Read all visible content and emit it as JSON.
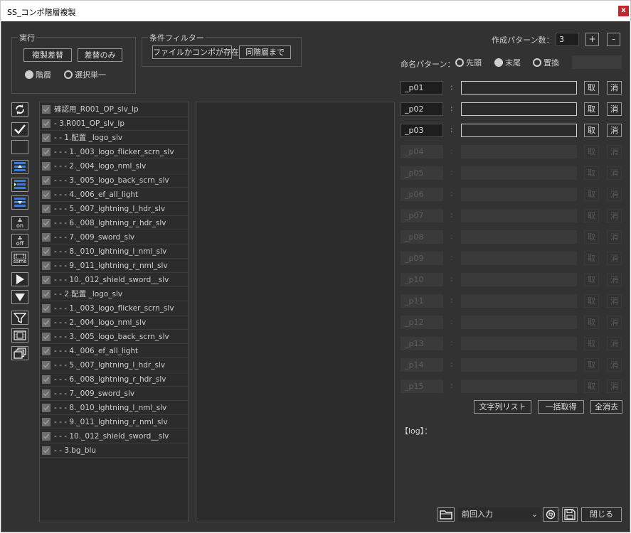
{
  "window": {
    "title": "SS_コンポ階層複製",
    "close": "x"
  },
  "execute": {
    "title": "実行",
    "duplicate_replace": "複製差替",
    "replace_only": "差替のみ",
    "modes": [
      {
        "label": "階層",
        "selected": true
      },
      {
        "label": "選択単一",
        "selected": false
      }
    ]
  },
  "filter": {
    "title": "条件フィルター",
    "file_or_comp": "ファイルかコンポが存在",
    "same_level": "同階層まで"
  },
  "pattern_count": {
    "label": "作成パターン数：",
    "value": "3",
    "plus": "+",
    "minus": "-"
  },
  "naming": {
    "label": "命名パターン：",
    "options": [
      {
        "label": "先頭",
        "selected": false
      },
      {
        "label": "末尾",
        "selected": true
      },
      {
        "label": "置換",
        "selected": false
      }
    ]
  },
  "patterns": [
    {
      "name": "_p01",
      "value": "",
      "get": "取",
      "del": "消",
      "enabled": true
    },
    {
      "name": "_p02",
      "value": "",
      "get": "取",
      "del": "消",
      "enabled": true
    },
    {
      "name": "_p03",
      "value": "",
      "get": "取",
      "del": "消",
      "enabled": true
    },
    {
      "name": "_p04",
      "value": "",
      "get": "取",
      "del": "消",
      "enabled": false
    },
    {
      "name": "_p05",
      "value": "",
      "get": "取",
      "del": "消",
      "enabled": false
    },
    {
      "name": "_p06",
      "value": "",
      "get": "取",
      "del": "消",
      "enabled": false
    },
    {
      "name": "_p07",
      "value": "",
      "get": "取",
      "del": "消",
      "enabled": false
    },
    {
      "name": "_p08",
      "value": "",
      "get": "取",
      "del": "消",
      "enabled": false
    },
    {
      "name": "_p09",
      "value": "",
      "get": "取",
      "del": "消",
      "enabled": false
    },
    {
      "name": "_p10",
      "value": "",
      "get": "取",
      "del": "消",
      "enabled": false
    },
    {
      "name": "_p11",
      "value": "",
      "get": "取",
      "del": "消",
      "enabled": false
    },
    {
      "name": "_p12",
      "value": "",
      "get": "取",
      "del": "消",
      "enabled": false
    },
    {
      "name": "_p13",
      "value": "",
      "get": "取",
      "del": "消",
      "enabled": false
    },
    {
      "name": "_p14",
      "value": "",
      "get": "取",
      "del": "消",
      "enabled": false
    },
    {
      "name": "_p15",
      "value": "",
      "get": "取",
      "del": "消",
      "enabled": false
    }
  ],
  "pattern_colon": ":",
  "actions": {
    "string_list": "文字列リスト",
    "get_all": "一括取得",
    "clear_all": "全消去"
  },
  "log_label": "【log】：",
  "footer": {
    "prev_input": "前回入力",
    "close": "閉じる"
  },
  "toolbar_icons": [
    "refresh-icon",
    "check-all-icon",
    "uncheck-all-icon",
    "collapse-up-icon",
    "indent-icon",
    "collapse-down-icon",
    "on-icon",
    "off-icon",
    "same-icon",
    "play-icon",
    "expand-down-icon",
    "filter-icon",
    "film-icon",
    "layers-icon"
  ],
  "toolbar_text": {
    "on": "on",
    "off": "off",
    "same": "same"
  },
  "tree": [
    {
      "label": "確認用_R001_OP_slv_lp",
      "checked": true
    },
    {
      "label": "-  3.R001_OP_slv_lp",
      "checked": true
    },
    {
      "label": "-  -  1.配置 _logo_slv",
      "checked": true
    },
    {
      "label": "-  -  -  1._003_logo_flicker_scrn_slv",
      "checked": true
    },
    {
      "label": "-  -  -  2._004_logo_nml_slv",
      "checked": true
    },
    {
      "label": "-  -  -  3._005_logo_back_scrn_slv",
      "checked": true
    },
    {
      "label": "-  -  -  4._006_ef_all_light",
      "checked": true
    },
    {
      "label": "-  -  -  5._007_lghtning_l_hdr_slv",
      "checked": true
    },
    {
      "label": "-  -  -  6._008_lghtning_r_hdr_slv",
      "checked": true
    },
    {
      "label": "-  -  -  7._009_sword_slv",
      "checked": true
    },
    {
      "label": "-  -  -  8._010_lghtning_l_nml_slv",
      "checked": true
    },
    {
      "label": "-  -  -  9._011_lghtning_r_nml_slv",
      "checked": true
    },
    {
      "label": "-  -  -  10._012_shield_sword__slv",
      "checked": true
    },
    {
      "label": "-  -  2.配置 _logo_slv",
      "checked": true
    },
    {
      "label": "-  -  -  1._003_logo_flicker_scrn_slv",
      "checked": true
    },
    {
      "label": "-  -  -  2._004_logo_nml_slv",
      "checked": true
    },
    {
      "label": "-  -  -  3._005_logo_back_scrn_slv",
      "checked": true
    },
    {
      "label": "-  -  -  4._006_ef_all_light",
      "checked": true
    },
    {
      "label": "-  -  -  5._007_lghtning_l_hdr_slv",
      "checked": true
    },
    {
      "label": "-  -  -  6._008_lghtning_r_hdr_slv",
      "checked": true
    },
    {
      "label": "-  -  -  7._009_sword_slv",
      "checked": true
    },
    {
      "label": "-  -  -  8._010_lghtning_l_nml_slv",
      "checked": true
    },
    {
      "label": "-  -  -  9._011_lghtning_r_nml_slv",
      "checked": true
    },
    {
      "label": "-  -  -  10._012_shield_sword__slv",
      "checked": true
    },
    {
      "label": "-  -  3.bg_blu",
      "checked": true
    }
  ]
}
